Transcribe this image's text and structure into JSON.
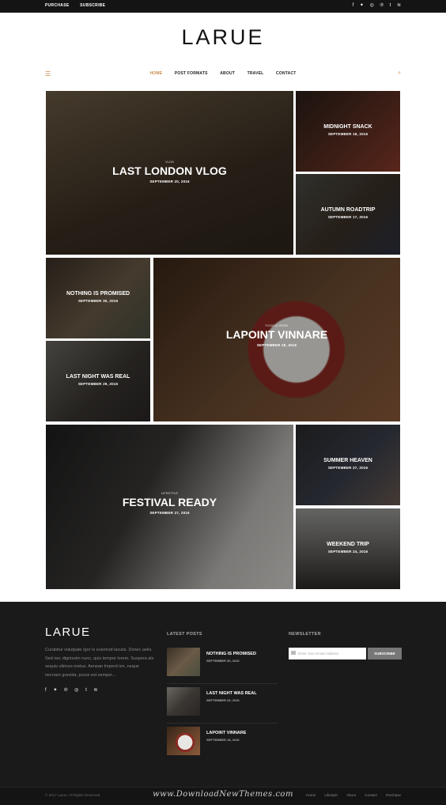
{
  "topbar": {
    "purchase": "PURCHASE",
    "subscribe": "SUBSCRIBE",
    "social": [
      "f",
      "t",
      "ig",
      "p",
      "t",
      "rss"
    ]
  },
  "logo": "LARUE",
  "nav": {
    "items": [
      "HOME",
      "POST FORMATS",
      "ABOUT",
      "TRAVEL",
      "CONTACT"
    ]
  },
  "tiles": [
    {
      "title": "LAST LONDON VLOG",
      "date": "SEPTEMBER 20, 2016",
      "category": "VLOG",
      "color": "#5c4a36"
    },
    {
      "title": "MIDNIGHT SNACK",
      "date": "SEPTEMBER 18, 2016",
      "color": "#3b2a22"
    },
    {
      "title": "AUTUMN ROADTRIP",
      "date": "SEPTEMBER 17, 2016",
      "color": "#4a4038"
    },
    {
      "title": "NOTHING IS PROMISED",
      "date": "SEPTEMBER 30, 2016",
      "color": "#5b4e40"
    },
    {
      "title": "LAPOINT VINNARE",
      "date": "SEPTEMBER 28, 2016",
      "category": "FOOD & DRINK",
      "color": "#6b4a30"
    },
    {
      "title": "LAST NIGHT WAS REAL",
      "date": "SEPTEMBER 29, 2016",
      "color": "#4f4a44"
    },
    {
      "title": "FESTIVAL READY",
      "date": "SEPTEMBER 27, 2016",
      "category": "LIFESTYLE",
      "color": "#4a4746"
    },
    {
      "title": "SUMMER HEAVEN",
      "date": "SEPTEMBER 27, 2016",
      "color": "#3f3d3a"
    },
    {
      "title": "WEEKEND TRIP",
      "date": "SEPTEMBER 24, 2016",
      "color": "#5a5957"
    }
  ],
  "footer": {
    "logo": "LARUE",
    "about": "Curabitur volutpate Igor Is euismod iaculis. Donec aelis. Sed nec dignissim nunc, quis tempor lorem. Suspera ale sequis ultrices metus. Aenean Imperd ien, neque necnare gravida, purus est semper...",
    "social": [
      "f",
      "t",
      "p",
      "ig",
      "t",
      "rss"
    ],
    "latest_posts_heading": "LATEST POSTS",
    "newsletter_heading": "NEWSLETTER",
    "posts": [
      {
        "title": "NOTHING IS PROMISED",
        "date": "SEPTEMBER 30, 2016",
        "color": "#5b4e40"
      },
      {
        "title": "LAST NIGHT WAS REAL",
        "date": "SEPTEMBER 29, 2016",
        "color": "#4f4a44"
      },
      {
        "title": "LAPOINT VINNARE",
        "date": "SEPTEMBER 18, 2016",
        "color": "#8a5a3a"
      }
    ],
    "newsletter_placeholder": "Enter Your Email Address",
    "subscribe_label": "SUBSCRIBE"
  },
  "bottom": {
    "copyright": "© 2017 Larue. All Rights Reserved.",
    "watermark": "www.DownloadNewThemes.com",
    "links": [
      "Home",
      "Lifestyle",
      "About",
      "Contact",
      "Purchase"
    ]
  },
  "colors": {
    "accent": "#c88a4a",
    "footer": "#1a1a1a"
  }
}
